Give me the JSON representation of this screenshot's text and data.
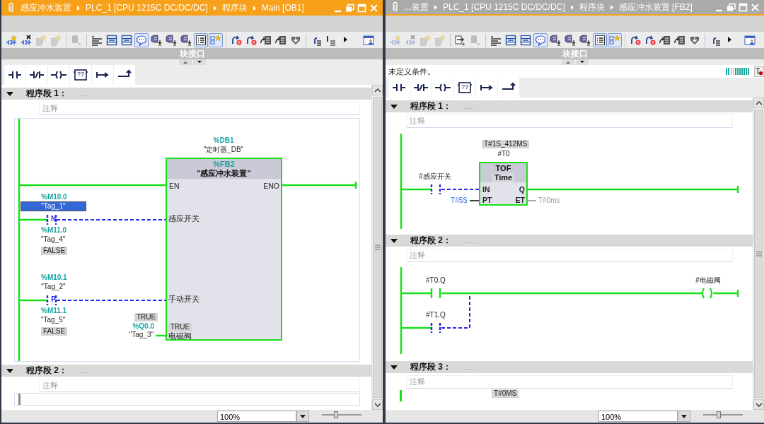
{
  "panes": [
    {
      "active": true,
      "title": {
        "path": [
          "感应冲水装置",
          "PLC_1 [CPU 1215C DC/DC/DC]",
          "程序块",
          "Main [OB1]"
        ]
      },
      "toolbar": [
        {
          "kind": "network_add",
          "pressed": false,
          "disabled": false
        },
        {
          "kind": "network_delete",
          "pressed": false,
          "disabled": false
        },
        {
          "kind": "rows_star",
          "pressed": false,
          "disabled": true
        },
        {
          "kind": "rows_star",
          "pressed": false,
          "disabled": true
        },
        {
          "kind": "separator"
        },
        {
          "kind": "block_db",
          "pressed": false,
          "disabled": true
        },
        {
          "kind": "separator"
        },
        {
          "kind": "align",
          "pressed": false,
          "disabled": false
        },
        {
          "kind": "list_box",
          "pressed": false,
          "disabled": false
        },
        {
          "kind": "list_box",
          "pressed": false,
          "disabled": false
        },
        {
          "kind": "comment",
          "pressed": true,
          "disabled": false
        },
        {
          "kind": "tag_down",
          "pressed": false,
          "disabled": false
        },
        {
          "kind": "tag_down",
          "pressed": false,
          "disabled": false
        },
        {
          "kind": "tag_down",
          "pressed": false,
          "disabled": false
        },
        {
          "kind": "bullets",
          "pressed": true,
          "disabled": false
        },
        {
          "kind": "favorites",
          "pressed": true,
          "disabled": false
        },
        {
          "kind": "separator"
        },
        {
          "kind": "jump_x",
          "pressed": false,
          "disabled": false
        },
        {
          "kind": "jump_x",
          "pressed": false,
          "disabled": false
        },
        {
          "kind": "page_arrow",
          "pressed": false,
          "disabled": false
        },
        {
          "kind": "page_arrow",
          "pressed": false,
          "disabled": false
        },
        {
          "kind": "shield",
          "pressed": false,
          "disabled": false
        },
        {
          "kind": "separator"
        },
        {
          "kind": "call_lines",
          "pressed": false,
          "disabled": false
        },
        {
          "kind": "more_lines",
          "pressed": false,
          "disabled": false
        },
        {
          "kind": "overflow",
          "pressed": false,
          "disabled": false
        },
        {
          "kind": "window",
          "pressed": false,
          "disabled": false
        }
      ],
      "interface_label": "块接口",
      "palette": [
        {
          "kind": "no_contact"
        },
        {
          "kind": "nc_contact"
        },
        {
          "kind": "coil"
        },
        {
          "kind": "empty_box",
          "label": "??"
        },
        {
          "kind": "open_branch"
        },
        {
          "kind": "close_branch"
        }
      ],
      "networks": [
        {
          "label": "程序段 1：",
          "dots": ".....",
          "comment": "注释",
          "expanded": true,
          "diagram": {
            "kind": "fb_call",
            "instance": {
              "address": "%DB1",
              "name": "\"定时器_DB\""
            },
            "block": {
              "address": "%FB2",
              "name": "\"感应冲水装置\""
            },
            "en": "EN",
            "eno": "ENO",
            "inputs": [
              {
                "pin": "感应开关",
                "address": "%M10.0",
                "tag": "\"Tag_1\"",
                "selected": true,
                "edge": "N",
                "edge_address": "%M11.0",
                "edge_tag": "\"Tag_4\"",
                "value": "FALSE",
                "powered": false
              },
              {
                "pin": "手动开关",
                "address": "%M10.1",
                "tag": "\"Tag_2\"",
                "selected": false,
                "edge": "P",
                "edge_address": "%M11.1",
                "edge_tag": "\"Tag_5\"",
                "value": "FALSE",
                "powered": false
              }
            ],
            "output": {
              "pin": "电磁阀",
              "pin_value": "TRUE",
              "value": "TRUE",
              "address": "%Q0.0",
              "tag": "\"Tag_3\""
            }
          }
        },
        {
          "label": "程序段 2：",
          "dots": ".....",
          "comment": "注释",
          "expanded": true,
          "diagram": {
            "kind": "stub",
            "powered": false
          }
        }
      ],
      "zoom": "100%",
      "zoom_slider": {
        "level": 0.35
      }
    },
    {
      "active": false,
      "title": {
        "path": [
          "...装置",
          "PLC_1 [CPU 1215C DC/DC/DC]",
          "程序块",
          "感应冲水装置 [FB2]"
        ]
      },
      "toolbar": [
        {
          "kind": "network_add",
          "pressed": false,
          "disabled": true
        },
        {
          "kind": "network_delete",
          "pressed": false,
          "disabled": true
        },
        {
          "kind": "rows_star",
          "pressed": false,
          "disabled": true
        },
        {
          "kind": "rows_star",
          "pressed": false,
          "disabled": true
        },
        {
          "kind": "separator"
        },
        {
          "kind": "page_down",
          "pressed": false,
          "disabled": false
        },
        {
          "kind": "block_db",
          "pressed": false,
          "disabled": true
        },
        {
          "kind": "separator"
        },
        {
          "kind": "align",
          "pressed": false,
          "disabled": false
        },
        {
          "kind": "list_box",
          "pressed": false,
          "disabled": false
        },
        {
          "kind": "list_box",
          "pressed": false,
          "disabled": false
        },
        {
          "kind": "comment",
          "pressed": true,
          "disabled": false
        },
        {
          "kind": "tag_down",
          "pressed": false,
          "disabled": false
        },
        {
          "kind": "tag_down",
          "pressed": false,
          "disabled": false
        },
        {
          "kind": "tag_down",
          "pressed": false,
          "disabled": false
        },
        {
          "kind": "bullets",
          "pressed": true,
          "disabled": false
        },
        {
          "kind": "favorites",
          "pressed": true,
          "disabled": false
        },
        {
          "kind": "separator"
        },
        {
          "kind": "jump_x",
          "pressed": false,
          "disabled": false
        },
        {
          "kind": "jump_x",
          "pressed": false,
          "disabled": false
        },
        {
          "kind": "page_arrow",
          "pressed": false,
          "disabled": false
        },
        {
          "kind": "page_arrow",
          "pressed": false,
          "disabled": false
        },
        {
          "kind": "shield",
          "pressed": false,
          "disabled": false
        },
        {
          "kind": "separator"
        },
        {
          "kind": "call_lines",
          "pressed": false,
          "disabled": false
        },
        {
          "kind": "overflow",
          "pressed": false,
          "disabled": false
        },
        {
          "kind": "window",
          "pressed": false,
          "disabled": false
        }
      ],
      "interface_label": "块接口",
      "condition": "未定义条件。",
      "palette": [
        {
          "kind": "no_contact"
        },
        {
          "kind": "nc_contact"
        },
        {
          "kind": "coil"
        },
        {
          "kind": "empty_box",
          "label": "??"
        },
        {
          "kind": "open_branch"
        },
        {
          "kind": "close_branch"
        }
      ],
      "networks": [
        {
          "label": "程序段 1：",
          "dots": ".....",
          "comment": "注释",
          "expanded": true,
          "diagram": {
            "kind": "timer",
            "value": "T#1S_412MS",
            "instance": "#T0",
            "block_type": "TOF",
            "subtype": "Time",
            "pins": {
              "in": "IN",
              "q": "Q",
              "pt": "PT",
              "et": "ET"
            },
            "pt_value": "T#5S",
            "et_value": "T#0ms",
            "contact": {
              "operand": "#感应开关",
              "powered": false
            }
          }
        },
        {
          "label": "程序段 2：",
          "dots": ".....",
          "comment": "注释",
          "expanded": true,
          "diagram": {
            "kind": "parallel_coil",
            "contacts": [
              {
                "operand": "#T0.Q",
                "powered": true
              },
              {
                "operand": "#T1.Q",
                "powered": false
              }
            ],
            "coil": {
              "operand": "#电磁阀",
              "powered": true
            }
          }
        },
        {
          "label": "程序段 3：",
          "dots": ".....",
          "comment": "注释",
          "expanded": true,
          "diagram": {
            "kind": "stub",
            "powered": true,
            "value": "T#0MS"
          }
        }
      ],
      "zoom": "100%",
      "zoom_slider": {
        "level": 0.4
      }
    }
  ]
}
